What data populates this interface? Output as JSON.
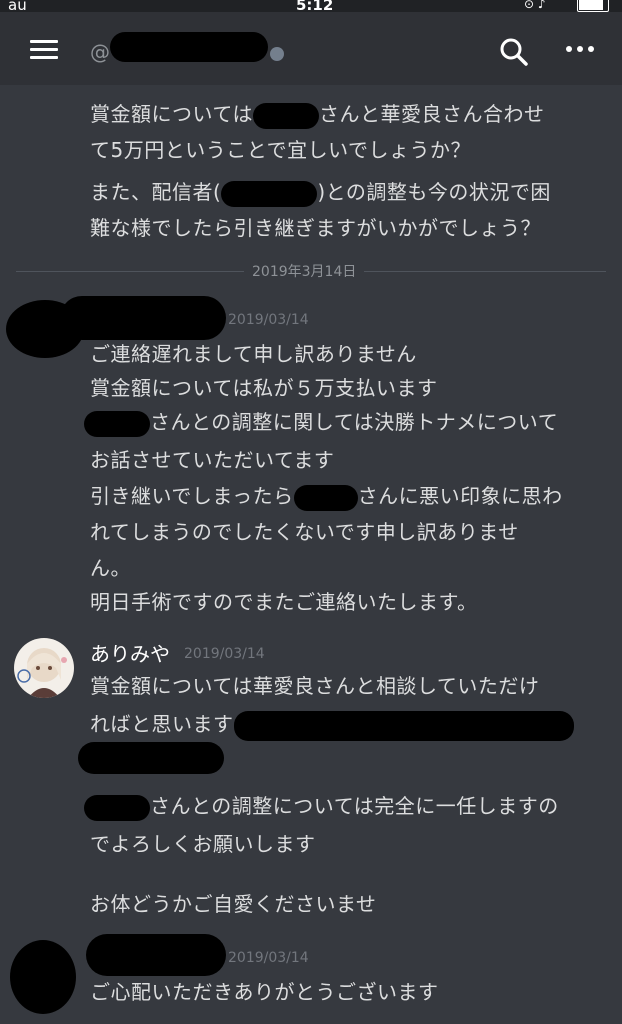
{
  "status_bar": {
    "carrier": "au",
    "time": "5:12",
    "right_icons": "⊙ ♪",
    "battery_level": 0.85
  },
  "header": {
    "channel_prefix": "@"
  },
  "messages": {
    "prev": {
      "line1a": "賞金額については",
      "line1b": "さんと華愛良さん合わせ",
      "line2": "て5万円ということで宜しいでしょうか？",
      "line3a": "また、配信者(",
      "line3b": ")との調整も今の状況で困",
      "line4": "難な様でしたら引き継ぎますがいかがでしょう？"
    },
    "date_divider": "2019年3月14日",
    "m1": {
      "timestamp": "2019/03/14",
      "l1": "ご連絡遅れまして申し訳ありません",
      "l2": "賞金額については私が５万支払います",
      "l3b": "さんとの調整に関しては決勝トナメについて",
      "l4": "お話させていただいてます",
      "l5a": "引き継いでしまったら",
      "l5b": "さんに悪い印象に思わ",
      "l6": "れてしまうのでしたくないです申し訳ありませ",
      "l7": "ん。",
      "l8": "明日手術ですのでまたご連絡いたします。"
    },
    "m2": {
      "username": "ありみや",
      "timestamp": "2019/03/14",
      "l1": "賞金額については華愛良さんと相談していただけ",
      "l2": "ればと思います",
      "l4b": "さんとの調整については完全に一任しますの",
      "l5": "でよろしくお願いします",
      "l6": "お体どうかご自愛くださいませ"
    },
    "m3": {
      "timestamp": "2019/03/14",
      "l1": "ご心配いただきありがとうございます"
    }
  }
}
